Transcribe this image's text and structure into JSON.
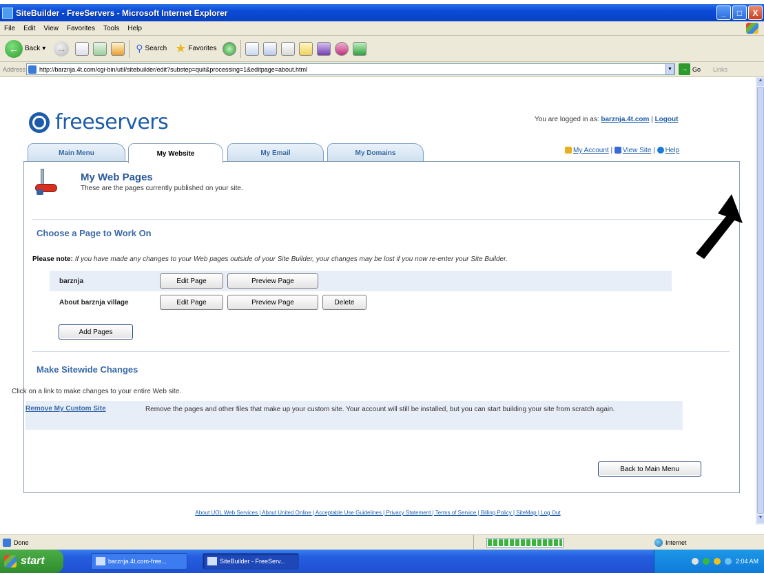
{
  "window": {
    "title": "SiteBuilder - FreeServers - Microsoft Internet Explorer",
    "min": "_",
    "max": "□",
    "close": "X"
  },
  "menu": [
    "File",
    "Edit",
    "View",
    "Favorites",
    "Tools",
    "Help"
  ],
  "toolbar": {
    "back": "Back",
    "search": "Search",
    "favorites": "Favorites"
  },
  "address": {
    "label": "Address",
    "url": "http://barznja.4t.com/cgi-bin/util/sitebuilder/edit?substep=quit&processing=1&editpage=about.html",
    "go": "Go",
    "links": "Links"
  },
  "header": {
    "logo": "freeservers",
    "logged_in_prefix": "You are logged in as:",
    "account": "barznja.4t.com",
    "separator": "|",
    "logout": "Logout"
  },
  "tabs": [
    "Main Menu",
    "My Website",
    "My Email",
    "My Domains"
  ],
  "top_links": {
    "my_account": "My Account",
    "view_site": "View Site",
    "help": "Help",
    "sep": "|"
  },
  "page": {
    "title": "My Web Pages",
    "subtitle": "These are the pages currently published on your site.",
    "choose_title": "Choose a Page to Work On",
    "note_label": "Please note:",
    "note_text": " If you have made any changes to your Web pages outside of your Site Builder, your changes may be lost if you now re-enter your Site Builder.",
    "pages": [
      {
        "name": "barznja",
        "edit": "Edit Page",
        "preview": "Preview Page"
      },
      {
        "name": "About barznja village",
        "edit": "Edit Page",
        "preview": "Preview Page",
        "delete": "Delete"
      }
    ],
    "add_pages": "Add Pages",
    "sitewide_title": "Make Sitewide Changes",
    "sitewide_desc": "Click on a link to make changes to your entire Web site.",
    "remove_link": "Remove My Custom Site",
    "remove_desc": "Remove the pages and other files that make up your custom site. Your account will still be installed, but you can start building your site from scratch again.",
    "back_button": "Back to Main Menu"
  },
  "footer": "About UOL Web Services | About United Online | Acceptable Use Guidelines | Privacy Statement | Terms of Service | Billing Policy | SiteMap | Log Out",
  "status": {
    "text": "Done",
    "zone": "Internet"
  },
  "taskbar": {
    "start": "start",
    "tasks": [
      "barznja.4t.com-free...",
      "SiteBuilder - FreeServ..."
    ],
    "time": "2:04 AM"
  },
  "colors": {
    "accent": "#1c5ca8",
    "panel_border": "#8aa0b8",
    "shaded_row": "#e8eef8"
  }
}
